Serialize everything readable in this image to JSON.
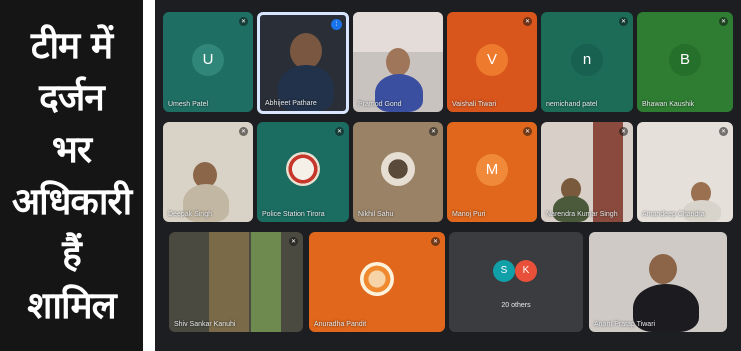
{
  "headline": {
    "lines": [
      "टीम में",
      "दर्जन",
      "भर",
      "अधिकारी",
      "हैं",
      "शामिल"
    ]
  },
  "meeting": {
    "tiles": [
      {
        "name": "Umesh Patel",
        "initial": "U",
        "bg": "#1e6e64"
      },
      {
        "name": "Abhijeet Pathare",
        "camera": true,
        "speaking": true
      },
      {
        "name": "Pramod Gond",
        "camera": true
      },
      {
        "name": "Vaishali Tiwari",
        "initial": "V",
        "bg": "#d8551c"
      },
      {
        "name": "nemichand patel",
        "initial": "n",
        "bg": "#1c6c57"
      },
      {
        "name": "Bhawan Kaushik",
        "initial": "B",
        "bg": "#2e7d32"
      },
      {
        "name": "Deepak Singh",
        "camera": true
      },
      {
        "name": "Police Station Tirora",
        "logo": true
      },
      {
        "name": "Nikhil Sahu",
        "camera": true
      },
      {
        "name": "Manoj Puri",
        "initial": "M",
        "bg": "#e0671c"
      },
      {
        "name": "Narendra Kumar Singh",
        "camera": true
      },
      {
        "name": "Amandeep Chandra",
        "camera": true
      },
      {
        "name": "Shiv Sankar Kanuhi",
        "camera": true
      },
      {
        "name": "Anuradha Pandit",
        "logo": true
      },
      {
        "name": "20 others",
        "initials": [
          "S",
          "K"
        ]
      },
      {
        "name": "Anant Pratap Tiwari",
        "camera": true
      }
    ],
    "mic_glyph": "✕",
    "speaking_glyph": "⦙",
    "colors": {
      "bg": "#1d1e21",
      "others_s": "#12a0a8",
      "others_k": "#e8503a"
    }
  }
}
